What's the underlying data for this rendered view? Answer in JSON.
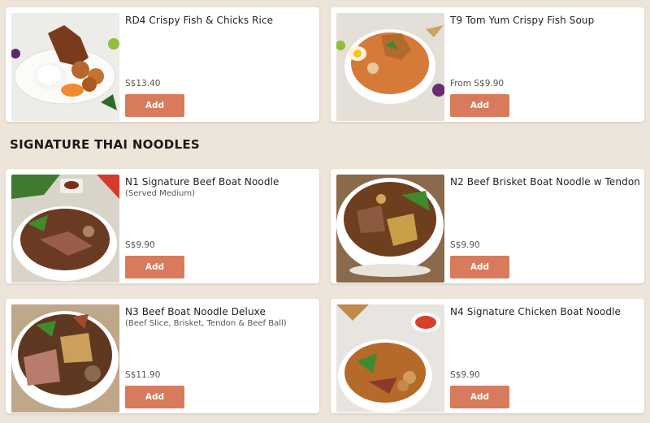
{
  "top_items": [
    {
      "title": "RD4 Crispy Fish & Chicks Rice",
      "desc": "",
      "price": "S$13.40",
      "add_label": "Add",
      "image_icon": "crispy-fish-rice-image"
    },
    {
      "title": "T9 Tom Yum Crispy Fish Soup",
      "desc": "",
      "price": "From S$9.90",
      "add_label": "Add",
      "image_icon": "tom-yum-soup-image"
    }
  ],
  "section": {
    "title": "SIGNATURE THAI NOODLES",
    "items": [
      {
        "title": "N1    Signature Beef Boat Noodle",
        "desc": "(Served Medium)",
        "price": "S$9.90",
        "add_label": "Add",
        "image_icon": "beef-noodle-image"
      },
      {
        "title": "N2    Beef Brisket Boat Noodle w Tendon",
        "desc": "",
        "price": "S$9.90",
        "add_label": "Add",
        "image_icon": "brisket-noodle-image"
      },
      {
        "title": "N3    Beef Boat Noodle Deluxe",
        "desc": "(Beef Slice, Brisket, Tendon & Beef Ball)",
        "price": "S$11.90",
        "add_label": "Add",
        "image_icon": "deluxe-noodle-image"
      },
      {
        "title": "N4    Signature Chicken Boat Noodle",
        "desc": "",
        "price": "S$9.90",
        "add_label": "Add",
        "image_icon": "chicken-noodle-image"
      }
    ]
  },
  "colors": {
    "page_bg": "#ede5d9",
    "card_bg": "#ffffff",
    "button": "#d87a5c"
  }
}
